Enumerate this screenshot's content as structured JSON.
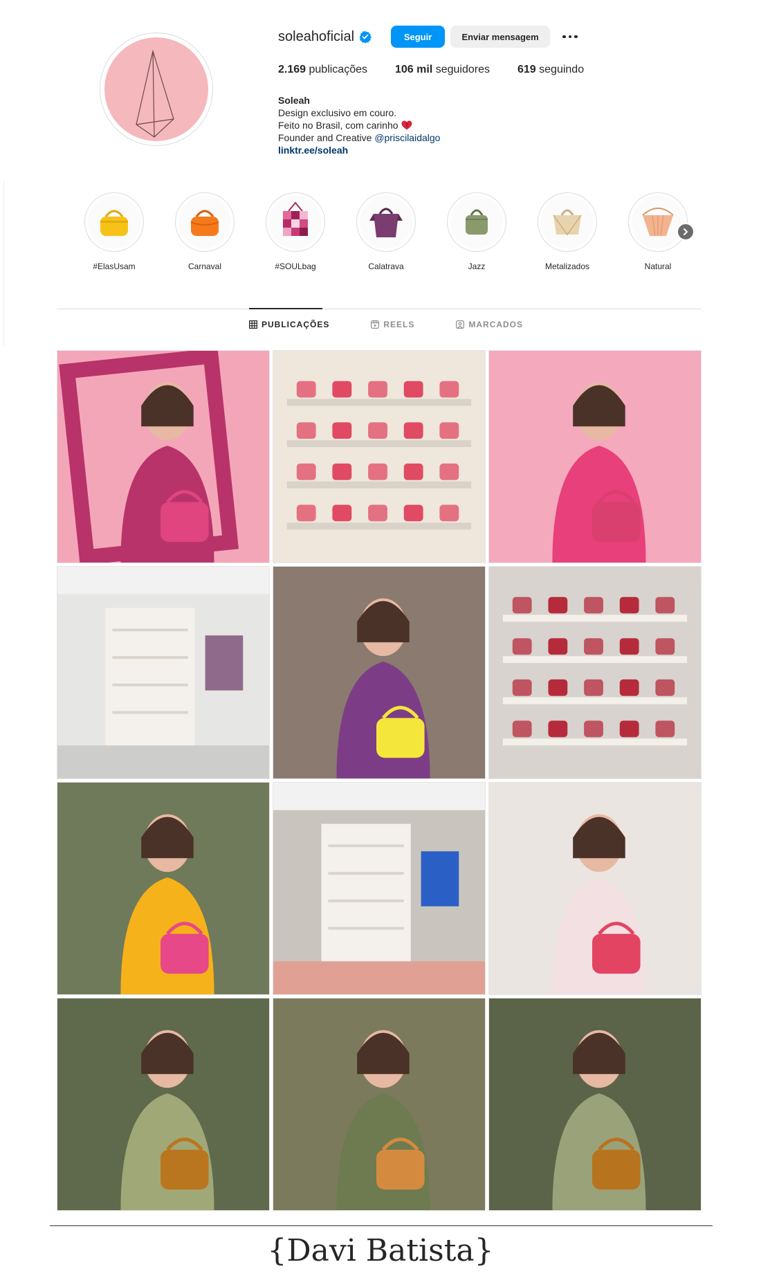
{
  "profile": {
    "username": "soleahoficial",
    "follow_label": "Seguir",
    "message_label": "Enviar mensagem",
    "stats": [
      {
        "value": "2.169",
        "label": "publicações"
      },
      {
        "value": "106 mil",
        "label": "seguidores"
      },
      {
        "value": "619",
        "label": "seguindo"
      }
    ],
    "bio": {
      "name": "Soleah",
      "line1": "Design exclusivo em couro.",
      "line2": "Feito no Brasil, com carinho",
      "line3_prefix": "Founder and Creative ",
      "line3_mention": "@priscilaidalgo",
      "link": "linktr.ee/soleah"
    }
  },
  "highlights": [
    {
      "label": "#ElasUsam",
      "color": "#f7c218"
    },
    {
      "label": "Carnaval",
      "color": "#f57a1c"
    },
    {
      "label": "#SOULbag",
      "color": "#c94a86"
    },
    {
      "label": "Calatrava",
      "color": "#7b3c70"
    },
    {
      "label": "Jazz",
      "color": "#8a9a6a"
    },
    {
      "label": "Metalizados",
      "color": "#e9d2ae"
    },
    {
      "label": "Natural",
      "color": "#f2b48e"
    }
  ],
  "tabs": [
    {
      "label": "PUBLICAÇÕES",
      "active": true
    },
    {
      "label": "REELS",
      "active": false
    },
    {
      "label": "MARCADOS",
      "active": false
    }
  ],
  "posts": [
    {
      "bg": "#f4a6b9",
      "accent": "#b8336a",
      "subject": "#e0457f",
      "type": "portrait-frame"
    },
    {
      "bg": "#efe6dc",
      "accent": "#d9d2c8",
      "subject": "#e04a63",
      "type": "shelves"
    },
    {
      "bg": "#f4a9bd",
      "accent": "#e8407a",
      "subject": "#d93f6f",
      "type": "portrait"
    },
    {
      "bg": "#e6e6e4",
      "accent": "#bdbdbd",
      "subject": "#8f6a8a",
      "type": "store"
    },
    {
      "bg": "#8a7a70",
      "accent": "#7d3d86",
      "subject": "#f5e63c",
      "type": "portrait"
    },
    {
      "bg": "#d8d3ce",
      "accent": "#f3efe9",
      "subject": "#b62b3c",
      "type": "shelves"
    },
    {
      "bg": "#6f7a5a",
      "accent": "#f6b21a",
      "subject": "#e74888",
      "type": "portrait"
    },
    {
      "bg": "#c9c4bd",
      "accent": "#f08a78",
      "subject": "#2a5fc6",
      "type": "store"
    },
    {
      "bg": "#eae5e0",
      "accent": "#f2e0e3",
      "subject": "#e24462",
      "type": "portrait"
    },
    {
      "bg": "#5f6a4c",
      "accent": "#a1a878",
      "subject": "#b9761f",
      "type": "portrait"
    },
    {
      "bg": "#7b7a5c",
      "accent": "#6e7a4f",
      "subject": "#d48b40",
      "type": "portrait"
    },
    {
      "bg": "#5b6349",
      "accent": "#9aa27a",
      "subject": "#b8731e",
      "type": "portrait"
    }
  ],
  "footer": {
    "signature": "{Davi Batista}"
  }
}
